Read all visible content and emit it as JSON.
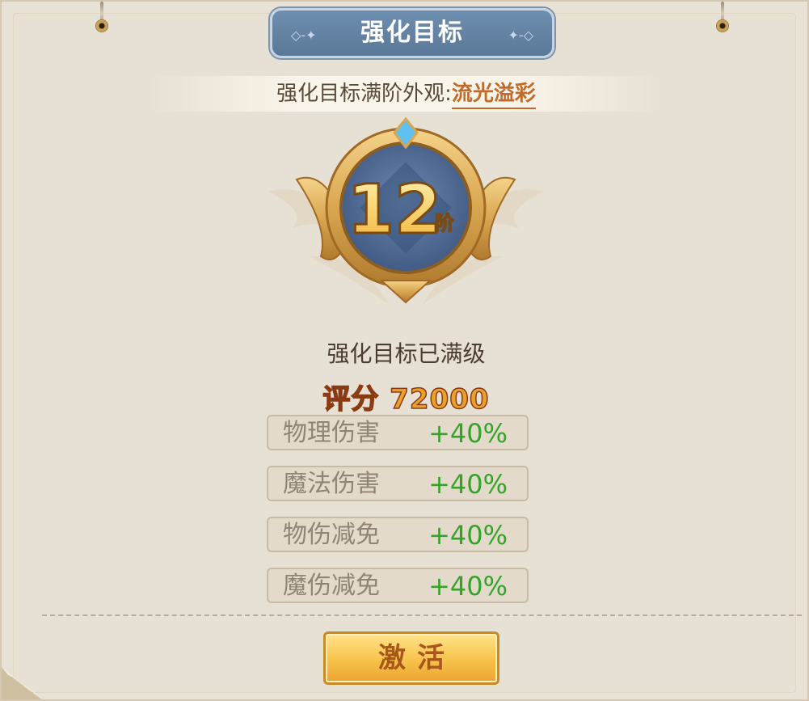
{
  "panel": {
    "title": "强化目标",
    "subtitle_label": "强化目标满阶外观:",
    "subtitle_link": "流光溢彩"
  },
  "badge": {
    "level_number": "12",
    "level_unit": "阶"
  },
  "status": {
    "text": "强化目标已满级",
    "score_label": "评分",
    "score_value": "72000"
  },
  "stats": [
    {
      "name": "物理伤害",
      "value": "+40%"
    },
    {
      "name": "魔法伤害",
      "value": "+40%"
    },
    {
      "name": "物伤减免",
      "value": "+40%"
    },
    {
      "name": "魔伤减免",
      "value": "+40%"
    }
  ],
  "action": {
    "button_label": "激活"
  },
  "colors": {
    "title_plate": "#5a7898",
    "link": "#c26a2a",
    "stat_value": "#35a32a",
    "score": "#e8a22c",
    "button": "#f7c24a"
  }
}
